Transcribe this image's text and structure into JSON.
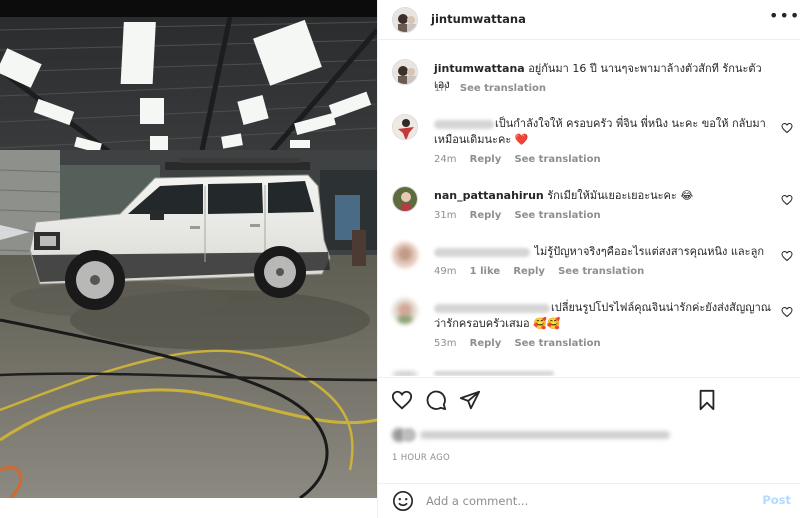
{
  "post": {
    "author": "jintumwattana",
    "caption_author": "jintumwattana",
    "caption": "อยู่กันมา 16 ปี นานๆจะพามาล้างตัวสักที รักนะตัวเอง",
    "caption_time": "1h",
    "see_translation": "See translation",
    "more_icon": "•••"
  },
  "comments": [
    {
      "username_blurred": true,
      "text": "เป็นกำลังใจให้ ครอบครัว พี่จิน พี่หนิง นะคะ ขอให้ กลับมาเหมือนเดิมนะคะ",
      "emoji": "❤️",
      "time": "24m",
      "likes": "",
      "reply": "Reply",
      "see_translation": "See translation"
    },
    {
      "username": "nan_pattanahirun",
      "text": "รักเมียให้มันเยอะเยอะนะคะ",
      "emoji": "😂",
      "time": "31m",
      "likes": "",
      "reply": "Reply",
      "see_translation": "See translation"
    },
    {
      "username_blurred": true,
      "text": "ไม่รู้ปัญหาจริงๆคืออะไรแต่สงสารคุณหนิง และลูก",
      "emoji": "",
      "time": "49m",
      "likes": "1 like",
      "reply": "Reply",
      "see_translation": "See translation"
    },
    {
      "username_blurred": true,
      "text": "เปลี่ยนรูปโปรไฟล์คุณจินน่ารักค่ะยังส่งสัญญาณว่ารักครอบครัวเสมอ",
      "emoji": "🥰🥰",
      "time": "53m",
      "likes": "",
      "reply": "Reply",
      "see_translation": "See translation"
    }
  ],
  "actions": {
    "like_icon": "heart-outline",
    "comment_icon": "speech-bubble",
    "share_icon": "paper-plane",
    "save_icon": "bookmark",
    "timestamp": "1 HOUR AGO"
  },
  "add_comment": {
    "placeholder": "Add a comment...",
    "post_label": "Post"
  },
  "colors": {
    "link": "#0095f6",
    "post_disabled": "#b3dbff",
    "secondary_text": "#8e8e8e",
    "heart_red": "#ed4956"
  }
}
